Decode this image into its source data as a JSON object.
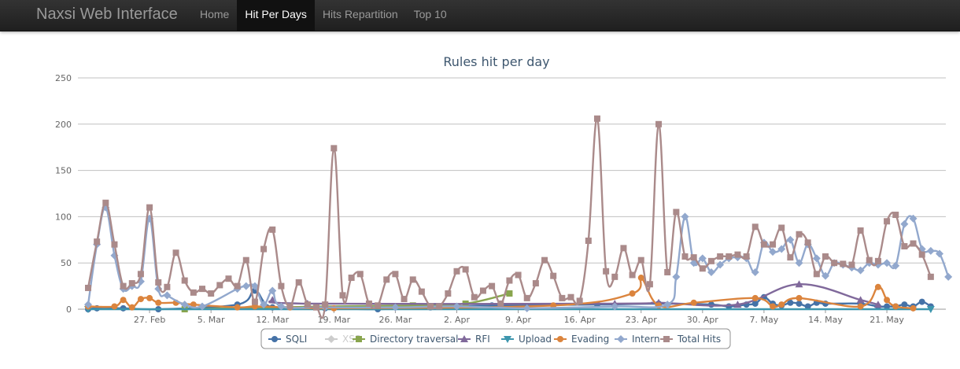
{
  "app": {
    "brand": "Naxsi Web Interface"
  },
  "nav": {
    "items": [
      {
        "label": "Home",
        "active": false
      },
      {
        "label": "Hit Per Days",
        "active": true
      },
      {
        "label": "Hits Repartition",
        "active": false
      },
      {
        "label": "Top 10",
        "active": false
      }
    ]
  },
  "chart_data": {
    "type": "line",
    "title": "Rules hit per day",
    "ylim": [
      0,
      250
    ],
    "yticks": [
      0,
      50,
      100,
      150,
      200,
      250
    ],
    "grid": true,
    "legend_position": "bottom",
    "x_start": "2012-02-20",
    "x_end": "2012-05-27",
    "xticks": [
      {
        "label": "27. Feb",
        "date": "2012-02-27"
      },
      {
        "label": "5. Mar",
        "date": "2012-03-05"
      },
      {
        "label": "12. Mar",
        "date": "2012-03-12"
      },
      {
        "label": "19. Mar",
        "date": "2012-03-19"
      },
      {
        "label": "26. Mar",
        "date": "2012-03-26"
      },
      {
        "label": "2. Apr",
        "date": "2012-04-02"
      },
      {
        "label": "9. Apr",
        "date": "2012-04-09"
      },
      {
        "label": "16. Apr",
        "date": "2012-04-16"
      },
      {
        "label": "23. Apr",
        "date": "2012-04-23"
      },
      {
        "label": "30. Apr",
        "date": "2012-04-30"
      },
      {
        "label": "7. May",
        "date": "2012-05-07"
      },
      {
        "label": "14. May",
        "date": "2012-05-14"
      },
      {
        "label": "21. May",
        "date": "2012-05-21"
      }
    ],
    "series": [
      {
        "name": "SQLI",
        "color": "#4572A7",
        "marker": "circle",
        "visible": true,
        "points": [
          [
            "2012-02-20",
            0
          ],
          [
            "2012-02-21",
            1
          ],
          [
            "2012-02-24",
            1
          ],
          [
            "2012-02-28",
            0
          ],
          [
            "2012-03-08",
            5
          ],
          [
            "2012-03-10",
            20
          ],
          [
            "2012-03-12",
            2
          ],
          [
            "2012-03-18",
            1
          ],
          [
            "2012-03-24",
            0
          ],
          [
            "2012-03-30",
            2
          ],
          [
            "2012-04-06",
            4
          ],
          [
            "2012-04-18",
            5
          ],
          [
            "2012-04-25",
            6
          ],
          [
            "2012-05-01",
            5
          ],
          [
            "2012-05-03",
            3
          ],
          [
            "2012-05-05",
            5
          ],
          [
            "2012-05-06",
            6
          ],
          [
            "2012-05-07",
            13
          ],
          [
            "2012-05-08",
            6
          ],
          [
            "2012-05-09",
            4
          ],
          [
            "2012-05-10",
            7
          ],
          [
            "2012-05-11",
            6
          ],
          [
            "2012-05-12",
            3
          ],
          [
            "2012-05-13",
            7
          ],
          [
            "2012-05-14",
            6
          ],
          [
            "2012-05-18",
            6
          ],
          [
            "2012-05-20",
            3
          ],
          [
            "2012-05-21",
            3
          ],
          [
            "2012-05-22",
            3
          ],
          [
            "2012-05-23",
            5
          ],
          [
            "2012-05-24",
            3
          ],
          [
            "2012-05-25",
            8
          ],
          [
            "2012-05-26",
            3
          ]
        ]
      },
      {
        "name": "XSS",
        "color": "#BBBBBB",
        "marker": "diamond",
        "visible": false,
        "points": [
          [
            "2012-02-20",
            0
          ],
          [
            "2012-05-26",
            0
          ]
        ]
      },
      {
        "name": "Directory traversal",
        "color": "#89A54E",
        "marker": "square",
        "visible": true,
        "points": [
          [
            "2012-03-02",
            0
          ],
          [
            "2012-03-18",
            3
          ],
          [
            "2012-03-28",
            4
          ],
          [
            "2012-04-03",
            6
          ],
          [
            "2012-04-08",
            17
          ]
        ]
      },
      {
        "name": "RFI",
        "color": "#80699B",
        "marker": "triangle",
        "visible": true,
        "points": [
          [
            "2012-03-12",
            10
          ],
          [
            "2012-03-16",
            6
          ],
          [
            "2012-04-20",
            6
          ],
          [
            "2012-04-25",
            7
          ],
          [
            "2012-05-04",
            5
          ],
          [
            "2012-05-11",
            27
          ],
          [
            "2012-05-18",
            10
          ],
          [
            "2012-05-20",
            5
          ]
        ]
      },
      {
        "name": "Upload",
        "color": "#3D96AE",
        "marker": "triangle-down",
        "visible": true,
        "points": [
          [
            "2012-02-20",
            0
          ],
          [
            "2012-05-26",
            0
          ]
        ]
      },
      {
        "name": "Evading",
        "color": "#DB843D",
        "marker": "circle",
        "visible": true,
        "points": [
          [
            "2012-02-20",
            3
          ],
          [
            "2012-02-23",
            3
          ],
          [
            "2012-02-24",
            10
          ],
          [
            "2012-02-25",
            2
          ],
          [
            "2012-02-26",
            11
          ],
          [
            "2012-02-27",
            12
          ],
          [
            "2012-02-28",
            7
          ],
          [
            "2012-03-01",
            7
          ],
          [
            "2012-03-03",
            5
          ],
          [
            "2012-03-08",
            2
          ],
          [
            "2012-03-10",
            3
          ],
          [
            "2012-03-14",
            2
          ],
          [
            "2012-03-19",
            1
          ],
          [
            "2012-04-13",
            4
          ],
          [
            "2012-04-22",
            17
          ],
          [
            "2012-04-23",
            34
          ],
          [
            "2012-04-25",
            4
          ],
          [
            "2012-04-29",
            7
          ],
          [
            "2012-05-06",
            12
          ],
          [
            "2012-05-08",
            3
          ],
          [
            "2012-05-09",
            5
          ],
          [
            "2012-05-11",
            12
          ],
          [
            "2012-05-18",
            3
          ],
          [
            "2012-05-20",
            24
          ],
          [
            "2012-05-21",
            10
          ],
          [
            "2012-05-22",
            3
          ],
          [
            "2012-05-24",
            1
          ]
        ]
      },
      {
        "name": "Intern",
        "color": "#92A8CD",
        "marker": "diamond",
        "visible": true,
        "points": [
          [
            "2012-02-20",
            5
          ],
          [
            "2012-02-21",
            70
          ],
          [
            "2012-02-22",
            110
          ],
          [
            "2012-02-23",
            58
          ],
          [
            "2012-02-24",
            22
          ],
          [
            "2012-02-25",
            25
          ],
          [
            "2012-02-26",
            30
          ],
          [
            "2012-02-27",
            98
          ],
          [
            "2012-02-28",
            22
          ],
          [
            "2012-02-29",
            15
          ],
          [
            "2012-03-02",
            5
          ],
          [
            "2012-03-04",
            3
          ],
          [
            "2012-03-08",
            22
          ],
          [
            "2012-03-09",
            25
          ],
          [
            "2012-03-10",
            25
          ],
          [
            "2012-03-11",
            5
          ],
          [
            "2012-03-12",
            20
          ],
          [
            "2012-03-13",
            3
          ],
          [
            "2012-03-18",
            2
          ],
          [
            "2012-03-26",
            2
          ],
          [
            "2012-04-02",
            3
          ],
          [
            "2012-04-10",
            1
          ],
          [
            "2012-04-20",
            3
          ],
          [
            "2012-04-26",
            5
          ],
          [
            "2012-04-27",
            35
          ],
          [
            "2012-04-28",
            100
          ],
          [
            "2012-04-29",
            50
          ],
          [
            "2012-04-30",
            55
          ],
          [
            "2012-05-01",
            40
          ],
          [
            "2012-05-02",
            48
          ],
          [
            "2012-05-03",
            55
          ],
          [
            "2012-05-04",
            56
          ],
          [
            "2012-05-05",
            55
          ],
          [
            "2012-05-06",
            40
          ],
          [
            "2012-05-07",
            72
          ],
          [
            "2012-05-08",
            62
          ],
          [
            "2012-05-09",
            65
          ],
          [
            "2012-05-10",
            75
          ],
          [
            "2012-05-11",
            50
          ],
          [
            "2012-05-12",
            70
          ],
          [
            "2012-05-13",
            55
          ],
          [
            "2012-05-14",
            36
          ],
          [
            "2012-05-15",
            50
          ],
          [
            "2012-05-16",
            48
          ],
          [
            "2012-05-17",
            45
          ],
          [
            "2012-05-18",
            42
          ],
          [
            "2012-05-19",
            50
          ],
          [
            "2012-05-20",
            48
          ],
          [
            "2012-05-21",
            50
          ],
          [
            "2012-05-22",
            47
          ],
          [
            "2012-05-23",
            92
          ],
          [
            "2012-05-24",
            98
          ],
          [
            "2012-05-25",
            65
          ],
          [
            "2012-05-26",
            63
          ],
          [
            "2012-05-27",
            60
          ],
          [
            "2012-05-28",
            35
          ]
        ]
      },
      {
        "name": "Total Hits",
        "color": "#AA8A8A",
        "marker": "square",
        "visible": true,
        "points": [
          [
            "2012-02-20",
            23
          ],
          [
            "2012-02-21",
            73
          ],
          [
            "2012-02-22",
            115
          ],
          [
            "2012-02-23",
            70
          ],
          [
            "2012-02-24",
            25
          ],
          [
            "2012-02-25",
            28
          ],
          [
            "2012-02-26",
            38
          ],
          [
            "2012-02-27",
            110
          ],
          [
            "2012-02-28",
            29
          ],
          [
            "2012-02-29",
            24
          ],
          [
            "2012-03-01",
            61
          ],
          [
            "2012-03-02",
            31
          ],
          [
            "2012-03-03",
            18
          ],
          [
            "2012-03-04",
            22
          ],
          [
            "2012-03-05",
            17
          ],
          [
            "2012-03-06",
            26
          ],
          [
            "2012-03-07",
            33
          ],
          [
            "2012-03-08",
            25
          ],
          [
            "2012-03-09",
            53
          ],
          [
            "2012-03-10",
            8
          ],
          [
            "2012-03-11",
            65
          ],
          [
            "2012-03-12",
            86
          ],
          [
            "2012-03-13",
            25
          ],
          [
            "2012-03-14",
            3
          ],
          [
            "2012-03-15",
            29
          ],
          [
            "2012-03-16",
            5
          ],
          [
            "2012-03-17",
            2
          ],
          [
            "2012-03-18",
            5
          ],
          [
            "2012-03-19",
            174
          ],
          [
            "2012-03-20",
            15
          ],
          [
            "2012-03-21",
            34
          ],
          [
            "2012-03-22",
            38
          ],
          [
            "2012-03-23",
            6
          ],
          [
            "2012-03-24",
            4
          ],
          [
            "2012-03-25",
            32
          ],
          [
            "2012-03-26",
            38
          ],
          [
            "2012-03-27",
            11
          ],
          [
            "2012-03-28",
            32
          ],
          [
            "2012-03-29",
            19
          ],
          [
            "2012-03-30",
            3
          ],
          [
            "2012-03-31",
            3
          ],
          [
            "2012-04-01",
            17
          ],
          [
            "2012-04-02",
            41
          ],
          [
            "2012-04-03",
            43
          ],
          [
            "2012-04-04",
            13
          ],
          [
            "2012-04-05",
            20
          ],
          [
            "2012-04-06",
            25
          ],
          [
            "2012-04-07",
            6
          ],
          [
            "2012-04-08",
            31
          ],
          [
            "2012-04-09",
            37
          ],
          [
            "2012-04-10",
            12
          ],
          [
            "2012-04-11",
            28
          ],
          [
            "2012-04-12",
            53
          ],
          [
            "2012-04-13",
            36
          ],
          [
            "2012-04-14",
            12
          ],
          [
            "2012-04-15",
            13
          ],
          [
            "2012-04-16",
            9
          ],
          [
            "2012-04-17",
            74
          ],
          [
            "2012-04-18",
            206
          ],
          [
            "2012-04-19",
            41
          ],
          [
            "2012-04-20",
            35
          ],
          [
            "2012-04-21",
            66
          ],
          [
            "2012-04-22",
            37
          ],
          [
            "2012-04-23",
            53
          ],
          [
            "2012-04-24",
            27
          ],
          [
            "2012-04-25",
            200
          ],
          [
            "2012-04-26",
            40
          ],
          [
            "2012-04-27",
            105
          ],
          [
            "2012-04-28",
            57
          ],
          [
            "2012-04-29",
            56
          ],
          [
            "2012-04-30",
            44
          ],
          [
            "2012-05-01",
            52
          ],
          [
            "2012-05-02",
            57
          ],
          [
            "2012-05-03",
            57
          ],
          [
            "2012-05-04",
            59
          ],
          [
            "2012-05-05",
            57
          ],
          [
            "2012-05-06",
            89
          ],
          [
            "2012-05-07",
            70
          ],
          [
            "2012-05-08",
            70
          ],
          [
            "2012-05-09",
            88
          ],
          [
            "2012-05-10",
            56
          ],
          [
            "2012-05-11",
            81
          ],
          [
            "2012-05-12",
            72
          ],
          [
            "2012-05-13",
            38
          ],
          [
            "2012-05-14",
            57
          ],
          [
            "2012-05-15",
            50
          ],
          [
            "2012-05-16",
            49
          ],
          [
            "2012-05-17",
            48
          ],
          [
            "2012-05-18",
            85
          ],
          [
            "2012-05-19",
            53
          ],
          [
            "2012-05-20",
            52
          ],
          [
            "2012-05-21",
            95
          ],
          [
            "2012-05-22",
            102
          ],
          [
            "2012-05-23",
            68
          ],
          [
            "2012-05-24",
            71
          ],
          [
            "2012-05-25",
            59
          ],
          [
            "2012-05-26",
            35
          ]
        ]
      }
    ]
  }
}
